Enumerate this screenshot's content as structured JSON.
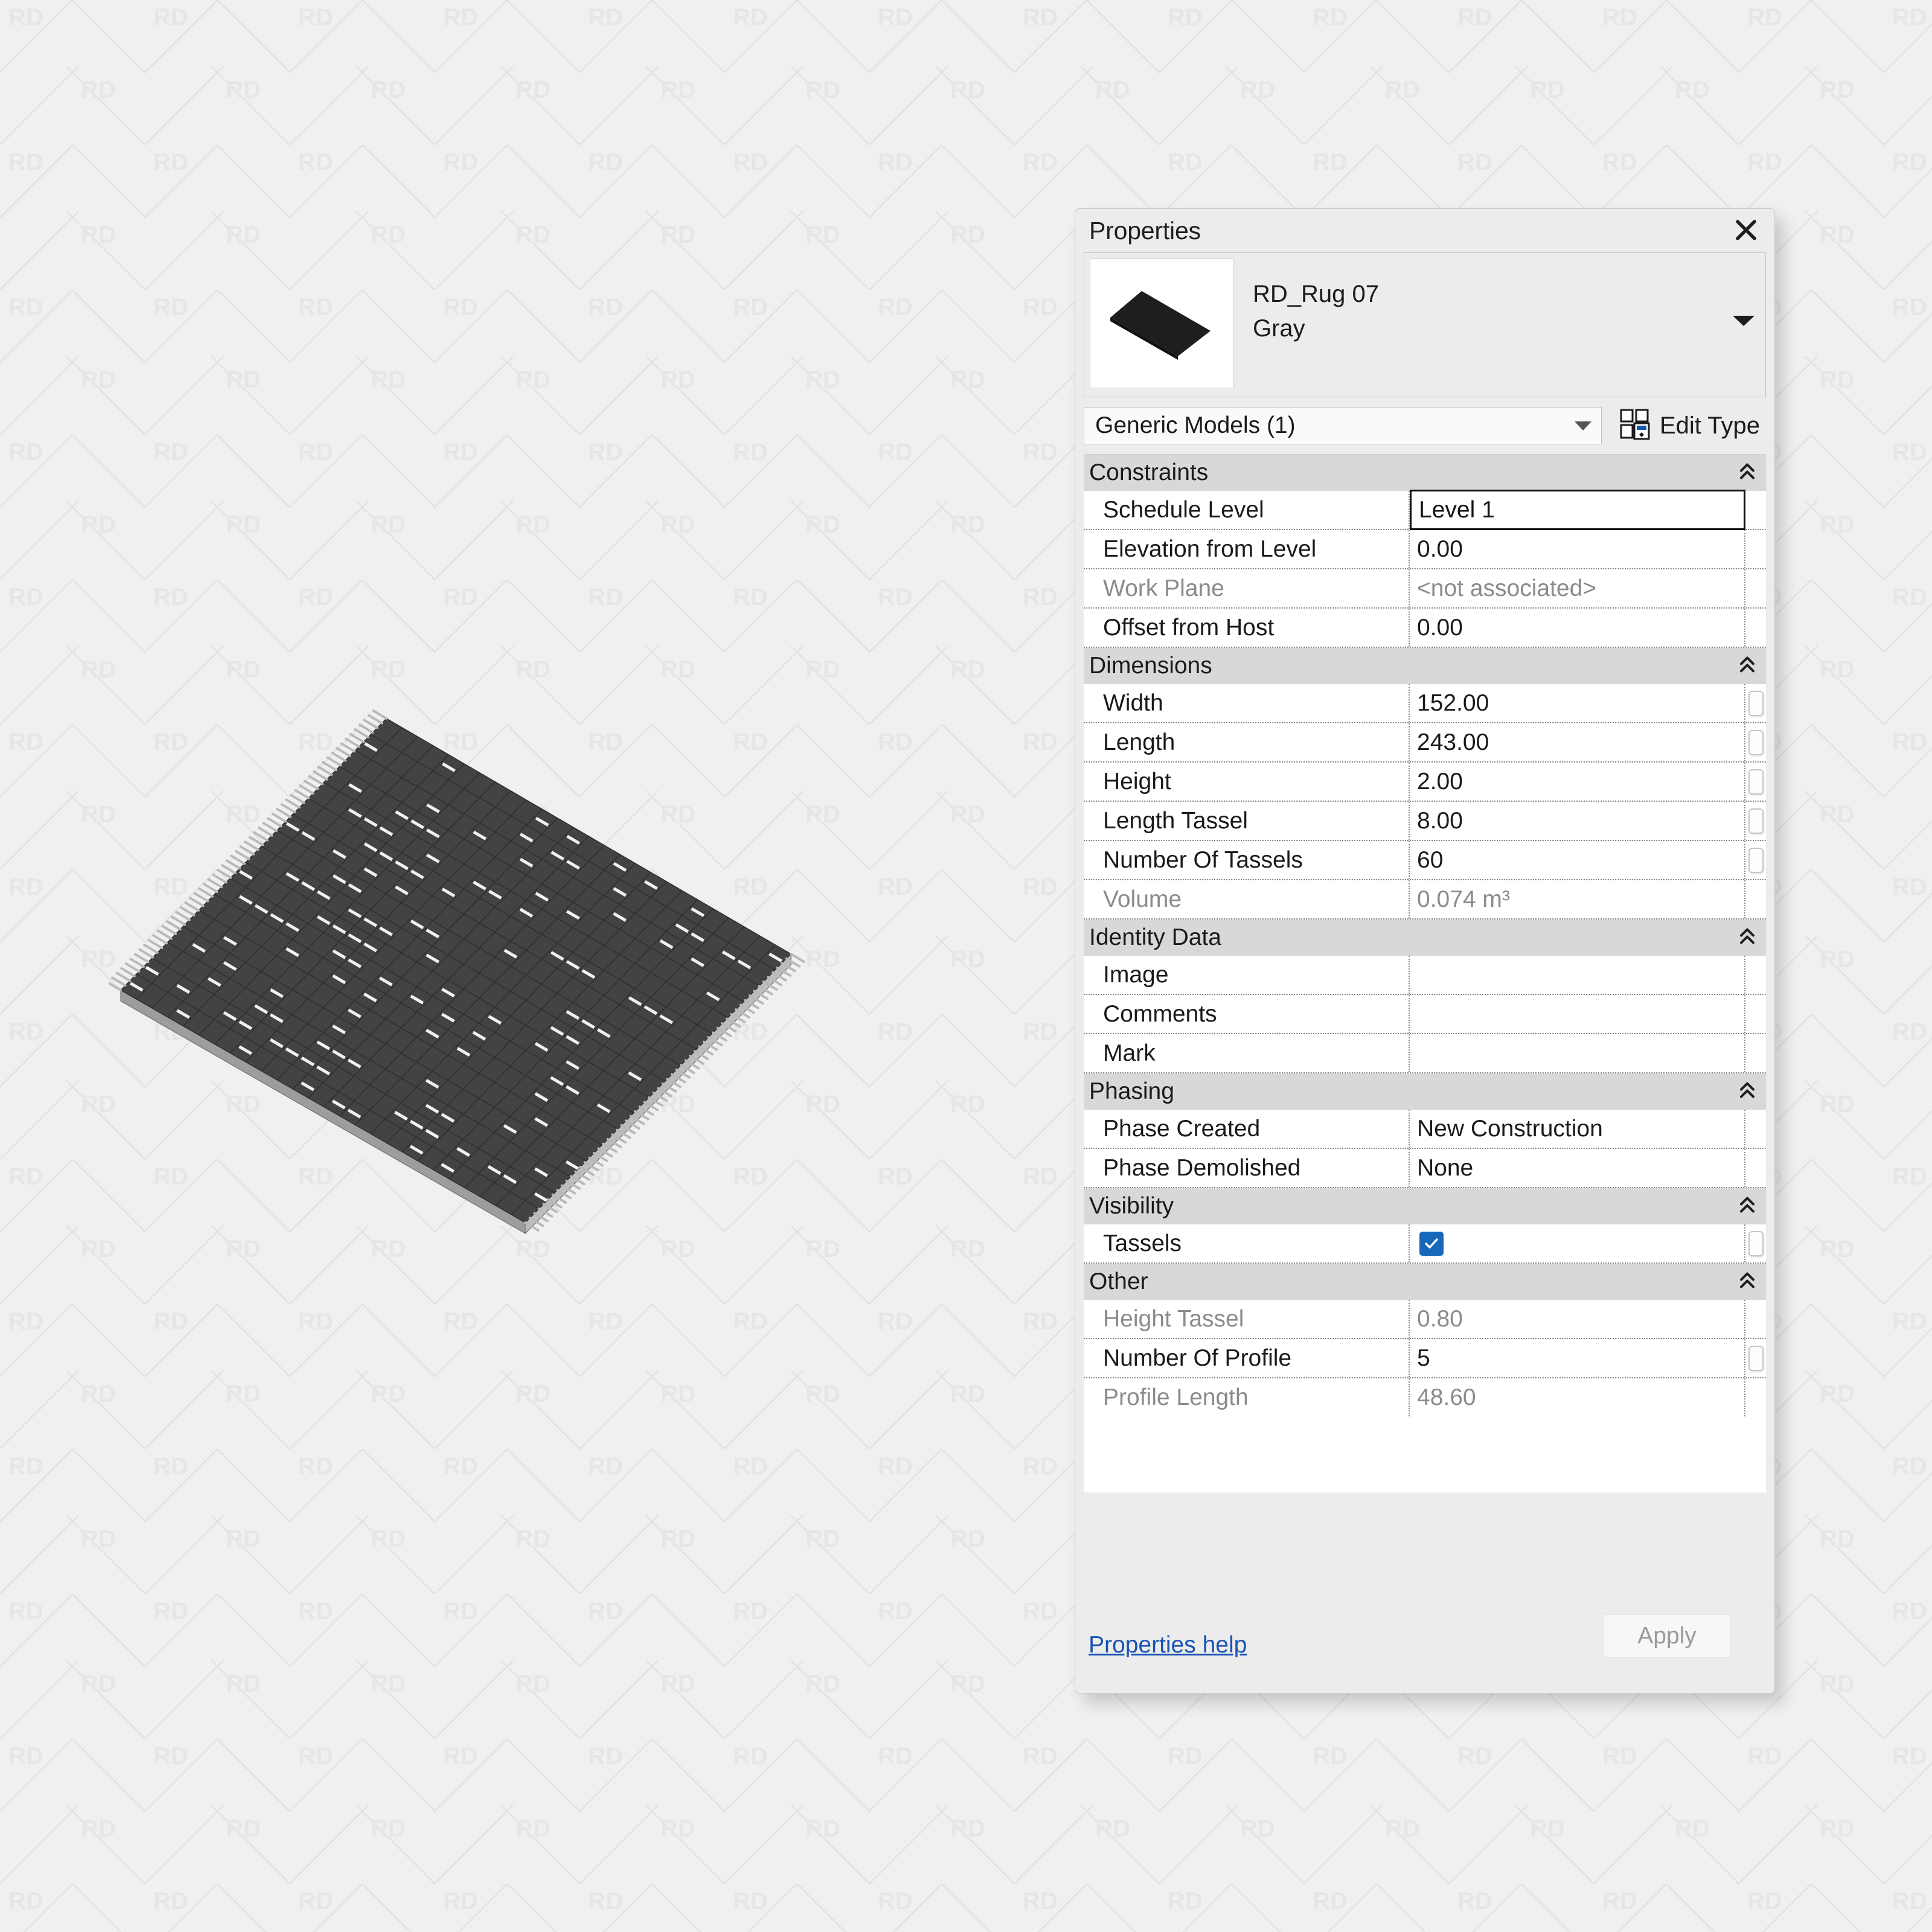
{
  "background": {
    "watermark_text": "RD",
    "canvas_color": "#f0f0f0"
  },
  "model": {
    "name": "RD_Rug 07 Gray rug 3D view",
    "body_color": "#3f3f3f",
    "fringe_color": "#cfcfcf"
  },
  "palette": {
    "title": "Properties",
    "close_icon": "close-icon",
    "preview": {
      "family": "RD_Rug 07",
      "type": "Gray",
      "expand_icon": "caret-down-icon"
    },
    "type_selector": {
      "value": "Generic Models (1)",
      "chevron_icon": "chevron-down-icon"
    },
    "edit_type": {
      "label": "Edit Type",
      "icon": "edit-type-icon"
    },
    "footer": {
      "help_label": "Properties help",
      "apply_label": "Apply",
      "apply_enabled": false
    },
    "collapse_icon": "double-chevron-up-icon",
    "accent_checkbox_color": "#1668b9",
    "link_color": "#1a53b5",
    "groups": [
      {
        "title": "Constraints",
        "rows": [
          {
            "name": "Schedule Level",
            "value": "Level 1",
            "editing": true,
            "greyed": false,
            "assoc": false
          },
          {
            "name": "Elevation from Level",
            "value": "0.00",
            "editing": false,
            "greyed": false,
            "assoc": false
          },
          {
            "name": "Work Plane",
            "value": "<not associated>",
            "editing": false,
            "greyed": true,
            "assoc": false
          },
          {
            "name": "Offset from Host",
            "value": "0.00",
            "editing": false,
            "greyed": false,
            "assoc": false
          }
        ]
      },
      {
        "title": "Dimensions",
        "rows": [
          {
            "name": "Width",
            "value": "152.00",
            "editing": false,
            "greyed": false,
            "assoc": true
          },
          {
            "name": "Length",
            "value": "243.00",
            "editing": false,
            "greyed": false,
            "assoc": true
          },
          {
            "name": "Height",
            "value": "2.00",
            "editing": false,
            "greyed": false,
            "assoc": true
          },
          {
            "name": "Length Tassel",
            "value": "8.00",
            "editing": false,
            "greyed": false,
            "assoc": true
          },
          {
            "name": "Number Of Tassels",
            "value": "60",
            "editing": false,
            "greyed": false,
            "assoc": true
          },
          {
            "name": "Volume",
            "value": "0.074 m³",
            "editing": false,
            "greyed": true,
            "assoc": false
          }
        ]
      },
      {
        "title": "Identity Data",
        "rows": [
          {
            "name": "Image",
            "value": "",
            "editing": false,
            "greyed": false,
            "assoc": false
          },
          {
            "name": "Comments",
            "value": "",
            "editing": false,
            "greyed": false,
            "assoc": false
          },
          {
            "name": "Mark",
            "value": "",
            "editing": false,
            "greyed": false,
            "assoc": false
          }
        ]
      },
      {
        "title": "Phasing",
        "rows": [
          {
            "name": "Phase Created",
            "value": "New Construction",
            "editing": false,
            "greyed": false,
            "assoc": false
          },
          {
            "name": "Phase Demolished",
            "value": "None",
            "editing": false,
            "greyed": false,
            "assoc": false
          }
        ]
      },
      {
        "title": "Visibility",
        "rows": [
          {
            "name": "Tassels",
            "value": "",
            "checkbox": true,
            "checked": true,
            "editing": false,
            "greyed": false,
            "assoc": true
          }
        ]
      },
      {
        "title": "Other",
        "rows": [
          {
            "name": "Height Tassel",
            "value": "0.80",
            "editing": false,
            "greyed": true,
            "assoc": false
          },
          {
            "name": "Number Of Profile",
            "value": "5",
            "editing": false,
            "greyed": false,
            "assoc": true
          },
          {
            "name": "Profile Length",
            "value": "48.60",
            "editing": false,
            "greyed": true,
            "assoc": false
          }
        ]
      }
    ]
  }
}
